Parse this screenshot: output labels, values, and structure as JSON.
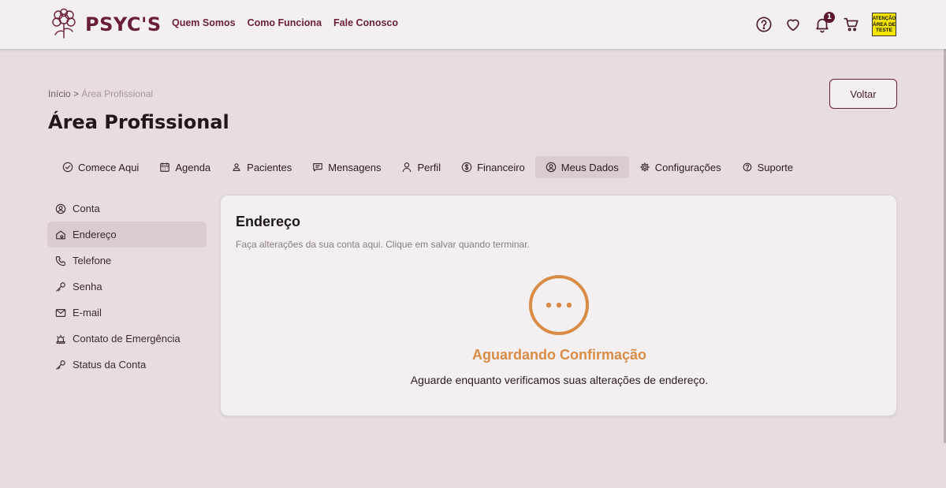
{
  "brand": {
    "name": "PSYC'S",
    "color": "#6b1e3c"
  },
  "topnav": [
    "Quem Somos",
    "Como Funciona",
    "Fale Conosco"
  ],
  "header": {
    "notification_count": "1",
    "test_badge": {
      "line1": "ATENÇÃO",
      "line2": "ÁREA DE",
      "line3": "TESTE"
    }
  },
  "breadcrumb": {
    "home": "Início",
    "separator": ">",
    "current": "Área Profissional"
  },
  "page_title": "Área Profissional",
  "back_button": "Voltar",
  "tabs": [
    {
      "label": "Comece Aqui",
      "icon": "check-circle-icon"
    },
    {
      "label": "Agenda",
      "icon": "calendar-icon"
    },
    {
      "label": "Pacientes",
      "icon": "user-icon"
    },
    {
      "label": "Mensagens",
      "icon": "message-icon"
    },
    {
      "label": "Perfil",
      "icon": "profile-icon"
    },
    {
      "label": "Financeiro",
      "icon": "dollar-icon"
    },
    {
      "label": "Meus Dados",
      "icon": "user-circle-icon",
      "active": true
    },
    {
      "label": "Configurações",
      "icon": "gear-icon"
    },
    {
      "label": "Suporte",
      "icon": "help-icon"
    }
  ],
  "sidemenu": [
    {
      "label": "Conta",
      "icon": "user-circle-icon"
    },
    {
      "label": "Endereço",
      "icon": "home-icon",
      "active": true
    },
    {
      "label": "Telefone",
      "icon": "phone-icon"
    },
    {
      "label": "Senha",
      "icon": "key-icon"
    },
    {
      "label": "E-mail",
      "icon": "mail-icon"
    },
    {
      "label": "Contato de Emergência",
      "icon": "siren-icon"
    },
    {
      "label": "Status da Conta",
      "icon": "key-icon"
    }
  ],
  "card": {
    "title": "Endereço",
    "subtitle": "Faça alterações da sua conta aqui. Clique em salvar quando terminar.",
    "status_title": "Aguardando Confirmação",
    "status_text": "Aguarde enquanto verificamos suas alterações de endereço.",
    "status_color": "#d98c45"
  }
}
